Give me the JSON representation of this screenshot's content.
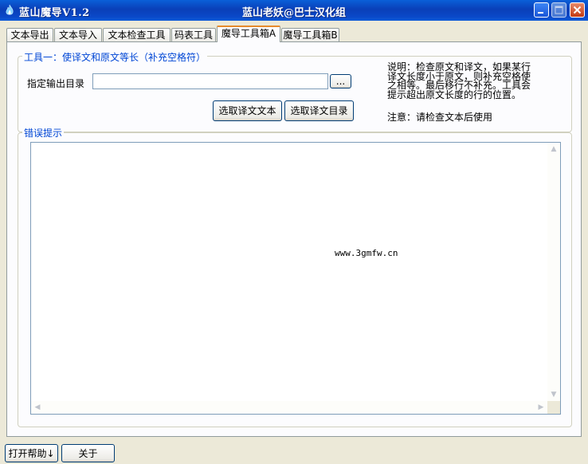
{
  "window": {
    "app_title": "蓝山魔导V1.2",
    "center_title": "蓝山老妖@巴士汉化组"
  },
  "tabs": [
    {
      "label": "文本导出"
    },
    {
      "label": "文本导入"
    },
    {
      "label": "文本检查工具"
    },
    {
      "label": "码表工具"
    },
    {
      "label": "魔导工具箱A"
    },
    {
      "label": "魔导工具箱B"
    }
  ],
  "tool1": {
    "legend": "工具一：使译文和原文等长（补充空格符）",
    "output_dir_label": "指定输出目录",
    "output_dir_value": "",
    "browse_label": "...",
    "select_text_label": "选取译文文本",
    "select_dir_label": "选取译文目录",
    "description": "说明：检查原文和译文，如果某行\n译文长度小于原文，则补充空格使\n之相等。最后移行不补充。工具会\n提示超出原文长度的行的位置。",
    "note": "注意：请检查文本后使用"
  },
  "errors": {
    "legend": "错误提示",
    "watermark": "www.3gmfw.cn"
  },
  "footer": {
    "help_label": "打开帮助↓",
    "about_label": "关于"
  }
}
